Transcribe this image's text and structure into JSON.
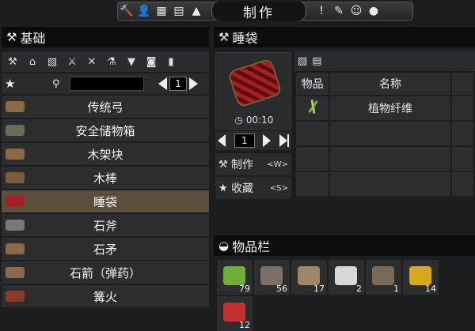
{
  "topbar": {
    "title": "制作",
    "left_icons": [
      "hammer-icon",
      "character-icon",
      "map-icon",
      "book-icon",
      "graduation-icon"
    ],
    "right_icons": [
      "exclamation-icon",
      "pencil-icon",
      "players-icon",
      "lightbulb-icon"
    ]
  },
  "left_panel": {
    "title": "基础",
    "categories": [
      "hammer-icon",
      "house-icon",
      "building-icon",
      "sword-icon",
      "tools-icon",
      "science-icon",
      "shirt-icon",
      "clothes-icon",
      "cylinder-icon"
    ],
    "page": "1",
    "recipes": [
      {
        "label": "传统弓",
        "icon": "bow-icon",
        "color": "#8a6b45"
      },
      {
        "label": "安全储物箱",
        "icon": "crate-icon",
        "color": "#6a6a55"
      },
      {
        "label": "木架块",
        "icon": "wood-frame-icon",
        "color": "#8b6a48"
      },
      {
        "label": "木棒",
        "icon": "club-icon",
        "color": "#7a5d40"
      },
      {
        "label": "睡袋",
        "icon": "sleeping-bag-icon",
        "color": "#a52020"
      },
      {
        "label": "石斧",
        "icon": "stone-axe-icon",
        "color": "#777a7a"
      },
      {
        "label": "石矛",
        "icon": "stone-spear-icon",
        "color": "#8a6a4a"
      },
      {
        "label": "石箭（弹药）",
        "icon": "stone-arrow-icon",
        "color": "#8a6a4a"
      },
      {
        "label": "篝火",
        "icon": "campfire-icon",
        "color": "#8a3a2a"
      }
    ]
  },
  "details": {
    "title": "睡袋",
    "craft_time": "00:10",
    "quantity": "1",
    "craft_label": "制作",
    "craft_key": "<W>",
    "fav_label": "收藏",
    "fav_key": "<S>",
    "col_item": "物品",
    "col_name": "名称",
    "ingredients": [
      {
        "icon": "plant-fiber-icon",
        "name": "植物纤维"
      }
    ]
  },
  "inventory": {
    "title": "物品栏",
    "slots": [
      {
        "icon": "plant-fiber-icon",
        "count": "79",
        "color": "#6fae38"
      },
      {
        "icon": "rock-icon",
        "count": "56",
        "color": "#7b6f66"
      },
      {
        "icon": "feather-icon",
        "count": "17",
        "color": "#9e8668"
      },
      {
        "icon": "bandage-icon",
        "count": "2",
        "color": "#d8d8d8"
      },
      {
        "icon": "stone-axe-icon",
        "count": "1",
        "color": "#7a6a55"
      },
      {
        "icon": "bullet-icon",
        "count": "14",
        "color": "#d9a81f"
      },
      {
        "icon": "first-aid-icon",
        "count": "12",
        "color": "#c42f2f"
      }
    ]
  }
}
